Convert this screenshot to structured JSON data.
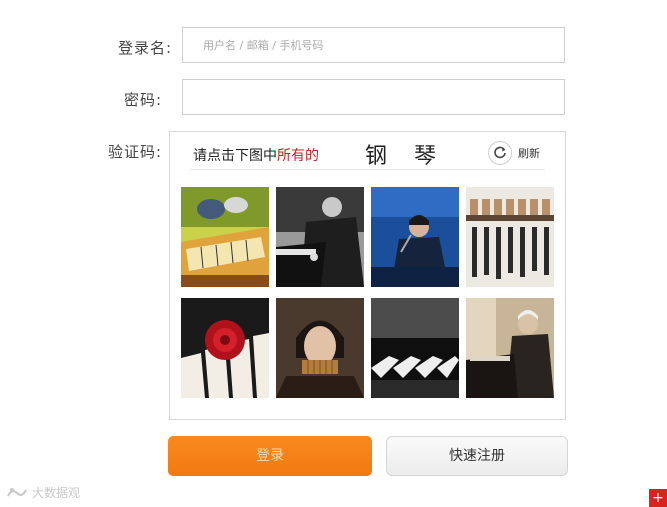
{
  "form": {
    "username_label": "登录名:",
    "username_placeholder": "用户名 / 邮箱 / 手机号码",
    "password_label": "密码:",
    "password_placeholder": "",
    "captcha_label": "验证码:"
  },
  "captcha": {
    "prompt_prefix": "请点击下图中",
    "prompt_emphasis": "所有的",
    "target_word": "钢 琴",
    "refresh_label": "刷新",
    "tiles": [
      {
        "subject": "cartoon cat on piano"
      },
      {
        "subject": "pianist black and white"
      },
      {
        "subject": "singer at keyboard on stage"
      },
      {
        "subject": "xylophone bars"
      },
      {
        "subject": "red rose on piano keys"
      },
      {
        "subject": "woman playing pan flute"
      },
      {
        "subject": "piano keys close-up"
      },
      {
        "subject": "portrait of pianist"
      }
    ]
  },
  "buttons": {
    "login_label": "登录",
    "register_label": "快速注册"
  },
  "watermark": {
    "text": "大数据观"
  },
  "colors": {
    "accent": "#f5801a",
    "emphasis": "#c0271c",
    "corner_badge": "#d9231d"
  }
}
